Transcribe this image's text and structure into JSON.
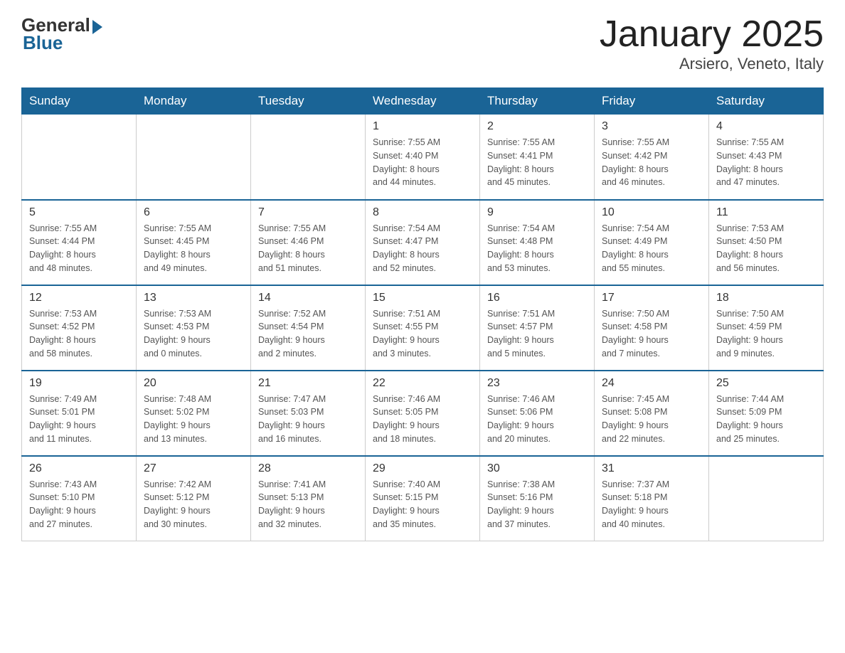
{
  "header": {
    "logo_general": "General",
    "logo_blue": "Blue",
    "month_title": "January 2025",
    "location": "Arsiero, Veneto, Italy"
  },
  "days_of_week": [
    "Sunday",
    "Monday",
    "Tuesday",
    "Wednesday",
    "Thursday",
    "Friday",
    "Saturday"
  ],
  "weeks": [
    [
      {
        "day": "",
        "info": ""
      },
      {
        "day": "",
        "info": ""
      },
      {
        "day": "",
        "info": ""
      },
      {
        "day": "1",
        "info": "Sunrise: 7:55 AM\nSunset: 4:40 PM\nDaylight: 8 hours\nand 44 minutes."
      },
      {
        "day": "2",
        "info": "Sunrise: 7:55 AM\nSunset: 4:41 PM\nDaylight: 8 hours\nand 45 minutes."
      },
      {
        "day": "3",
        "info": "Sunrise: 7:55 AM\nSunset: 4:42 PM\nDaylight: 8 hours\nand 46 minutes."
      },
      {
        "day": "4",
        "info": "Sunrise: 7:55 AM\nSunset: 4:43 PM\nDaylight: 8 hours\nand 47 minutes."
      }
    ],
    [
      {
        "day": "5",
        "info": "Sunrise: 7:55 AM\nSunset: 4:44 PM\nDaylight: 8 hours\nand 48 minutes."
      },
      {
        "day": "6",
        "info": "Sunrise: 7:55 AM\nSunset: 4:45 PM\nDaylight: 8 hours\nand 49 minutes."
      },
      {
        "day": "7",
        "info": "Sunrise: 7:55 AM\nSunset: 4:46 PM\nDaylight: 8 hours\nand 51 minutes."
      },
      {
        "day": "8",
        "info": "Sunrise: 7:54 AM\nSunset: 4:47 PM\nDaylight: 8 hours\nand 52 minutes."
      },
      {
        "day": "9",
        "info": "Sunrise: 7:54 AM\nSunset: 4:48 PM\nDaylight: 8 hours\nand 53 minutes."
      },
      {
        "day": "10",
        "info": "Sunrise: 7:54 AM\nSunset: 4:49 PM\nDaylight: 8 hours\nand 55 minutes."
      },
      {
        "day": "11",
        "info": "Sunrise: 7:53 AM\nSunset: 4:50 PM\nDaylight: 8 hours\nand 56 minutes."
      }
    ],
    [
      {
        "day": "12",
        "info": "Sunrise: 7:53 AM\nSunset: 4:52 PM\nDaylight: 8 hours\nand 58 minutes."
      },
      {
        "day": "13",
        "info": "Sunrise: 7:53 AM\nSunset: 4:53 PM\nDaylight: 9 hours\nand 0 minutes."
      },
      {
        "day": "14",
        "info": "Sunrise: 7:52 AM\nSunset: 4:54 PM\nDaylight: 9 hours\nand 2 minutes."
      },
      {
        "day": "15",
        "info": "Sunrise: 7:51 AM\nSunset: 4:55 PM\nDaylight: 9 hours\nand 3 minutes."
      },
      {
        "day": "16",
        "info": "Sunrise: 7:51 AM\nSunset: 4:57 PM\nDaylight: 9 hours\nand 5 minutes."
      },
      {
        "day": "17",
        "info": "Sunrise: 7:50 AM\nSunset: 4:58 PM\nDaylight: 9 hours\nand 7 minutes."
      },
      {
        "day": "18",
        "info": "Sunrise: 7:50 AM\nSunset: 4:59 PM\nDaylight: 9 hours\nand 9 minutes."
      }
    ],
    [
      {
        "day": "19",
        "info": "Sunrise: 7:49 AM\nSunset: 5:01 PM\nDaylight: 9 hours\nand 11 minutes."
      },
      {
        "day": "20",
        "info": "Sunrise: 7:48 AM\nSunset: 5:02 PM\nDaylight: 9 hours\nand 13 minutes."
      },
      {
        "day": "21",
        "info": "Sunrise: 7:47 AM\nSunset: 5:03 PM\nDaylight: 9 hours\nand 16 minutes."
      },
      {
        "day": "22",
        "info": "Sunrise: 7:46 AM\nSunset: 5:05 PM\nDaylight: 9 hours\nand 18 minutes."
      },
      {
        "day": "23",
        "info": "Sunrise: 7:46 AM\nSunset: 5:06 PM\nDaylight: 9 hours\nand 20 minutes."
      },
      {
        "day": "24",
        "info": "Sunrise: 7:45 AM\nSunset: 5:08 PM\nDaylight: 9 hours\nand 22 minutes."
      },
      {
        "day": "25",
        "info": "Sunrise: 7:44 AM\nSunset: 5:09 PM\nDaylight: 9 hours\nand 25 minutes."
      }
    ],
    [
      {
        "day": "26",
        "info": "Sunrise: 7:43 AM\nSunset: 5:10 PM\nDaylight: 9 hours\nand 27 minutes."
      },
      {
        "day": "27",
        "info": "Sunrise: 7:42 AM\nSunset: 5:12 PM\nDaylight: 9 hours\nand 30 minutes."
      },
      {
        "day": "28",
        "info": "Sunrise: 7:41 AM\nSunset: 5:13 PM\nDaylight: 9 hours\nand 32 minutes."
      },
      {
        "day": "29",
        "info": "Sunrise: 7:40 AM\nSunset: 5:15 PM\nDaylight: 9 hours\nand 35 minutes."
      },
      {
        "day": "30",
        "info": "Sunrise: 7:38 AM\nSunset: 5:16 PM\nDaylight: 9 hours\nand 37 minutes."
      },
      {
        "day": "31",
        "info": "Sunrise: 7:37 AM\nSunset: 5:18 PM\nDaylight: 9 hours\nand 40 minutes."
      },
      {
        "day": "",
        "info": ""
      }
    ]
  ]
}
